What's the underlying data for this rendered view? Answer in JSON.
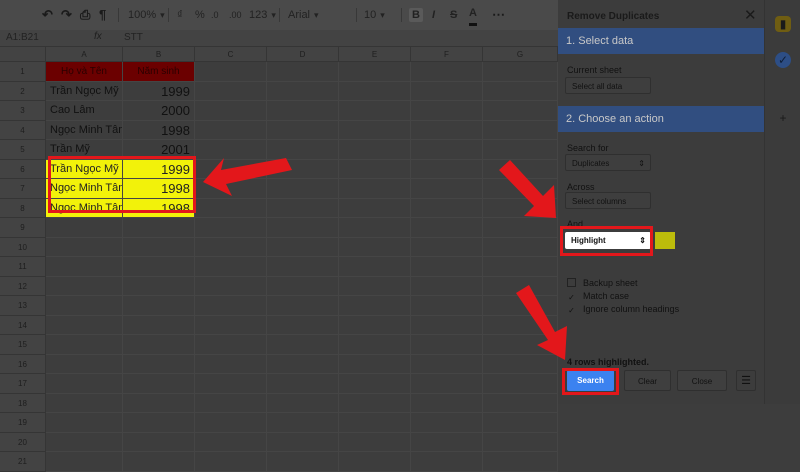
{
  "toolbar": {
    "zoom": "100%",
    "currency": "₫",
    "percent": "%",
    "decimal_less": ".0",
    "decimal_more": ".00",
    "number_format": "123",
    "font": "Arial",
    "font_size": "10",
    "bold": "B",
    "italic": "I",
    "strike": "S",
    "text_color": "A"
  },
  "formula_bar": {
    "name_box": "A1:B21",
    "fx": "fx",
    "value": "STT"
  },
  "sheet": {
    "columns": [
      "A",
      "B",
      "C",
      "D",
      "E",
      "F",
      "G"
    ],
    "row_numbers": [
      "1",
      "2",
      "3",
      "4",
      "5",
      "6",
      "7",
      "8",
      "9",
      "10",
      "11",
      "12",
      "13",
      "14",
      "15",
      "16",
      "17",
      "18",
      "19",
      "20",
      "21"
    ],
    "header": {
      "a": "Họ và Tên",
      "b": "Năm sinh"
    },
    "rows": [
      {
        "name": "Trần Ngọc Mỹ",
        "year": "1999"
      },
      {
        "name": "Cao Lâm",
        "year": "2000"
      },
      {
        "name": "Ngọc Minh Tâm",
        "year": "1998"
      },
      {
        "name": "Trần Mỹ",
        "year": "2001"
      },
      {
        "name": "Trần Ngọc Mỹ",
        "year": "1999"
      },
      {
        "name": "Ngọc Minh Tâm",
        "year": "1998"
      },
      {
        "name": "Ngọc Minh Tâm",
        "year": "1998"
      }
    ]
  },
  "panel": {
    "title": "Remove Duplicates",
    "section1": "1. Select data",
    "current_sheet_label": "Current sheet",
    "select_all_data": "Select all data",
    "section2": "2. Choose an action",
    "search_for_label": "Search for",
    "search_for_value": "Duplicates",
    "across_label": "Across",
    "across_value": "Select columns",
    "and_label": "And",
    "action_value": "Highlight",
    "backup_sheet": "Backup sheet",
    "match_case": "Match case",
    "ignore_headings": "Ignore column headings",
    "status": "4 rows highlighted.",
    "search_button": "Search",
    "clear_button": "Clear",
    "close_button": "Close"
  },
  "colors": {
    "highlight": "#f2f20a",
    "annotation_red": "#e3171b",
    "search_button": "#3b82f0",
    "header_fill": "#6b0000"
  }
}
